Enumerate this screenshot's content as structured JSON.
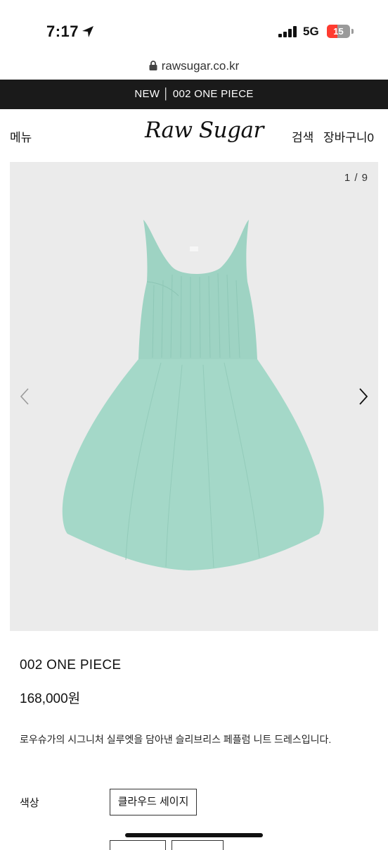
{
  "status": {
    "time": "7:17",
    "network": "5G",
    "battery": "15",
    "battery_level": 0.15,
    "icons": [
      "location-arrow-icon",
      "signal-bars-icon",
      "battery-icon"
    ]
  },
  "browser": {
    "url": "rawsugar.co.kr"
  },
  "promo": {
    "text": "NEW │ 002 ONE PIECE"
  },
  "header": {
    "menu": "메뉴",
    "logo": "Raw Sugar",
    "search": "검색",
    "cart": "장바구니0"
  },
  "gallery": {
    "counter": "1 / 9",
    "prev_icon": "chevron-left-icon",
    "next_icon": "chevron-right-icon"
  },
  "product": {
    "title": "002 ONE PIECE",
    "price": "168,000원",
    "description": "로우슈가의 시그니처 실루엣을 담아낸 슬리브리스 페플럼 니트 드레스입니다.",
    "color_label": "색상",
    "color_option": "클라우드 세이지"
  },
  "colors": {
    "promo_bg": "#1a1a1a",
    "dress": "#9ed3c3",
    "gallery_bg": "#ebebeb"
  }
}
